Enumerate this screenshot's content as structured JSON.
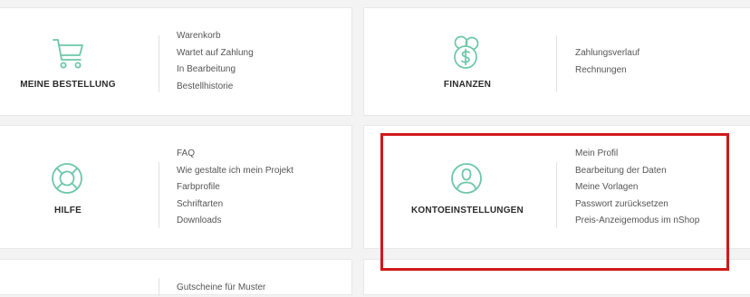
{
  "colors": {
    "accent": "#6cc7a8",
    "highlight": "#d01919"
  },
  "cards": [
    {
      "title": "MEINE BESTELLUNG",
      "icon": "shopping-cart-icon",
      "links": [
        "Warenkorb",
        "Wartet auf Zahlung",
        "In Bearbeitung",
        "Bestellhistorie"
      ]
    },
    {
      "title": "FINANZEN",
      "icon": "coins-dollar-icon",
      "links": [
        "Zahlungsverlauf",
        "Rechnungen"
      ]
    },
    {
      "title": "HILFE",
      "icon": "lifebuoy-icon",
      "links": [
        "FAQ",
        "Wie gestalte ich mein Projekt",
        "Farbprofile",
        "Schriftarten",
        "Downloads"
      ]
    },
    {
      "title": "KONTOEINSTELLUNGEN",
      "icon": "user-profile-icon",
      "links": [
        "Mein Profil",
        "Bearbeitung der Daten",
        "Meine Vorlagen",
        "Passwort zurücksetzen",
        "Preis-Anzeigemodus im nShop"
      ]
    },
    {
      "title": "",
      "icon": "",
      "links": [
        "Gutscheine für Muster"
      ]
    }
  ]
}
